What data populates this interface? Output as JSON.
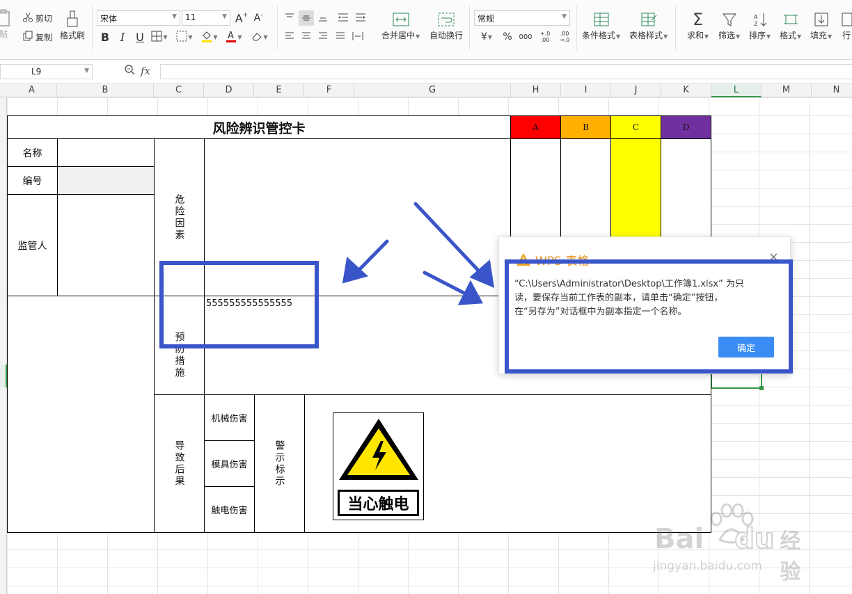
{
  "ribbon": {
    "cut": "剪切",
    "copy": "复制",
    "format_painter": "格式刷",
    "font_name": "宋体",
    "font_size": "11",
    "merge_center": "合并居中",
    "wrap_text": "自动换行",
    "number_format": "常规",
    "conditional_format": "条件格式",
    "table_style": "表格样式",
    "sum": "求和",
    "filter": "筛选",
    "sort": "排序",
    "format": "格式",
    "fill": "填充",
    "rows_cols": "行",
    "paste_partial": "贴",
    "currency_symbol": "¥",
    "percent_symbol": "%",
    "thousands_symbol": "000",
    "inc_decimal": "+.0 .00",
    "dec_decimal": ".00 →.0"
  },
  "formula_bar": {
    "cell_ref": "L9",
    "fx": "fx",
    "value": ""
  },
  "columns": [
    "A",
    "B",
    "C",
    "D",
    "E",
    "F",
    "G",
    "H",
    "I",
    "J",
    "K",
    "L",
    "M",
    "N"
  ],
  "selected_column": "L",
  "card": {
    "title": "风险辨识管控卡",
    "levels": [
      {
        "label": "A",
        "color": "#ff0000"
      },
      {
        "label": "B",
        "color": "#ffb000"
      },
      {
        "label": "C",
        "color": "#ffff00"
      },
      {
        "label": "D",
        "color": "#7030a0"
      }
    ],
    "name_label": "名称",
    "number_label": "编号",
    "supervisor_label": "监管人",
    "hazard_label": "危险因素",
    "prevention_label": "预防措施",
    "prevention_value": "555555555555555",
    "consequence_label": "导致后果",
    "consequences": [
      "机械伤害",
      "模具伤害",
      "触电伤害"
    ],
    "warning_label": "警示标示",
    "sign_text": "当心触电"
  },
  "dialog": {
    "title": "WPS 表格",
    "message_line1": "“C:\\Users\\Administrator\\Desktop\\工作簿1.xlsx” 为只",
    "message_line2": "读，要保存当前工作表的副本，请单击“确定”按钮，",
    "message_line3": "在“另存为”对话框中为副本指定一个名称。",
    "ok_label": "确定",
    "close_symbol": "×"
  },
  "watermark": {
    "brand": "Bai",
    "brand2": "du",
    "brand_cn": "经验",
    "url": "jingyan.baidu.com"
  },
  "colors": {
    "annotation_blue": "#3a55c9",
    "dialog_ok": "#3b8cf5",
    "dialog_title": "#e8911a",
    "selection_green": "#3a9a4a"
  }
}
